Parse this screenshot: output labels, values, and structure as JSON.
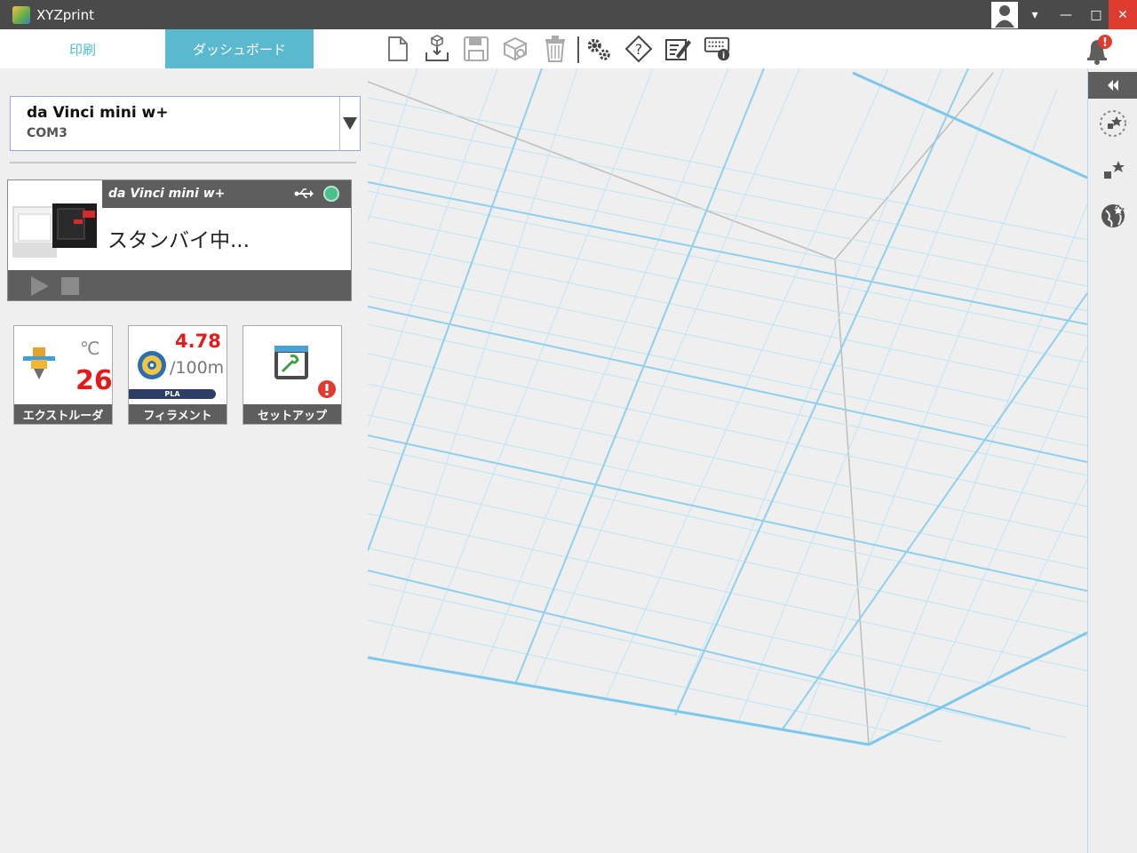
{
  "window": {
    "title": "XYZprint",
    "controls": {
      "minimize": "—",
      "maximize": "□",
      "close": "✕",
      "menu": "▾"
    }
  },
  "tabs": [
    {
      "label": "印刷"
    },
    {
      "label": "ダッシュボード"
    }
  ],
  "printer_select": {
    "name": "da Vinci mini w+",
    "port": "COM3"
  },
  "status_card": {
    "model": "da Vinci mini w+",
    "status": "スタンバイ中..."
  },
  "tiles": {
    "extruder": {
      "unit": "℃",
      "temperature": "26",
      "label": "エクストルーダ"
    },
    "filament": {
      "remaining": "4.78",
      "total": "/100m",
      "type": "PLA",
      "label": "フィラメント"
    },
    "setup": {
      "label": "セットアップ"
    }
  },
  "icons": [
    "app-icon",
    "user-icon",
    "new-file-icon",
    "import-icon",
    "save-icon",
    "object-icon",
    "trash-icon",
    "settings-icon",
    "help-icon",
    "edit-icon",
    "keyboard-info-icon",
    "bell-icon",
    "usb-icon",
    "play-icon",
    "stop-icon",
    "extruder-icon",
    "filament-spool-icon",
    "wrench-icon",
    "rail-collapse-icon",
    "view-icon"
  ],
  "colors": {
    "accent": "#5bb9cf",
    "temp": "#e41b1b",
    "grid": "#8fd0ef",
    "alert": "#e03b2f"
  }
}
